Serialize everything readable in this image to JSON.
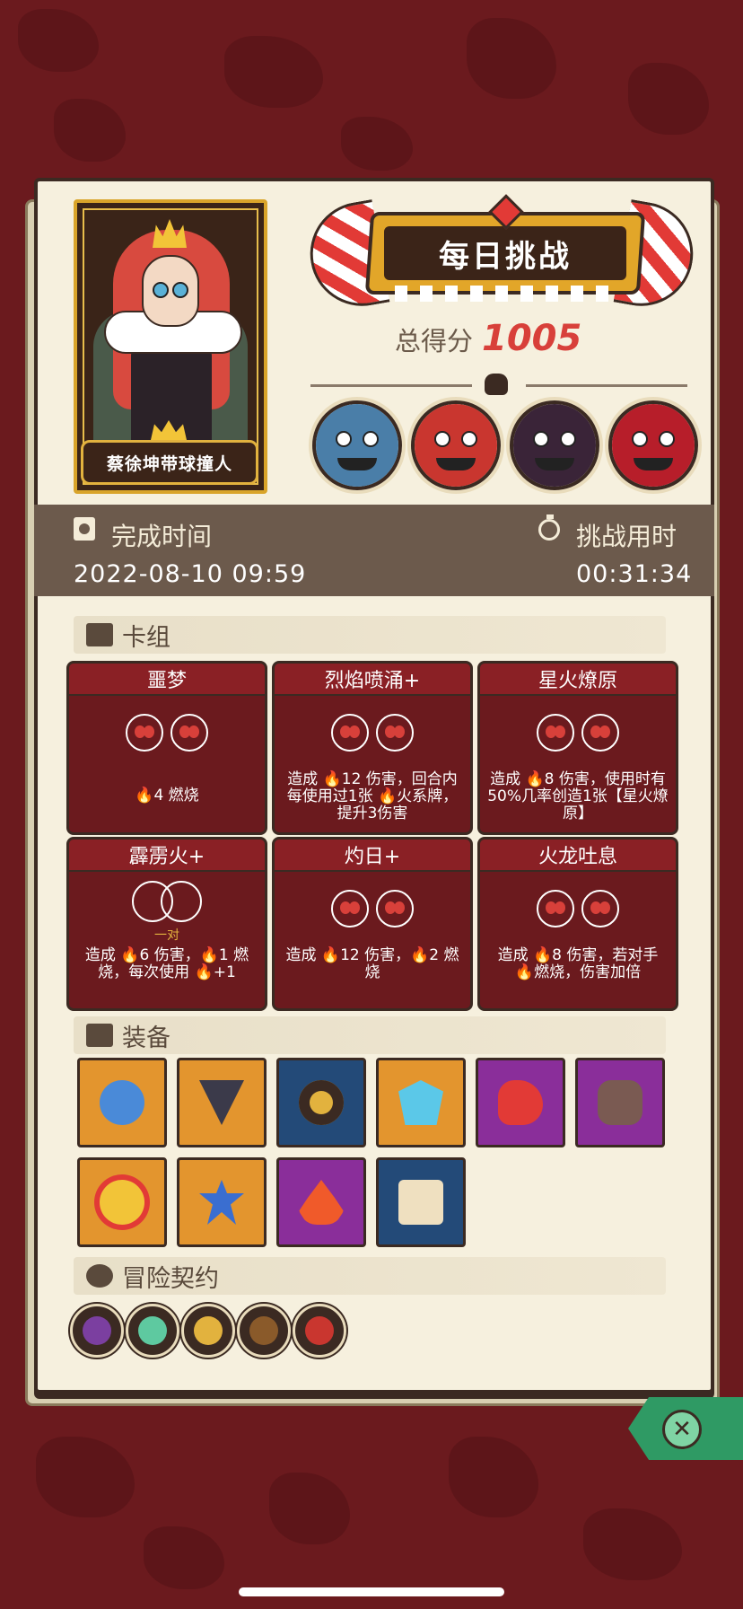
{
  "hero": {
    "name": "蔡徐坤带球撞人"
  },
  "header": {
    "title": "每日挑战",
    "score_label": "总得分",
    "score_value": "1005"
  },
  "enemies": [
    {
      "name": "blue-ogre",
      "color": "#4a7ea8"
    },
    {
      "name": "red-demon",
      "color": "#c9362f"
    },
    {
      "name": "pink-shadow",
      "color": "#3a2438"
    },
    {
      "name": "vampire",
      "color": "#b71e2a"
    }
  ],
  "time": {
    "complete_label": "完成时间",
    "complete_value": "2022-08-10 09:59",
    "challenge_label": "挑战用时",
    "challenge_value": "00:31:34"
  },
  "deck": {
    "label": "卡组",
    "cards": [
      {
        "title": "噩梦",
        "desc": "🔥4 燃烧",
        "cost": 2,
        "upgraded": false
      },
      {
        "title": "烈焰喷涌+",
        "desc": "造成 🔥12 伤害，回合内每使用过1张 🔥火系牌，提升3伤害",
        "cost": 2,
        "upgraded": true
      },
      {
        "title": "星火燎原",
        "desc": "造成 🔥8 伤害，使用时有50%几率创造1张【星火燎原】",
        "cost": 2,
        "upgraded": true
      },
      {
        "title": "霹雳火+",
        "desc": "造成 🔥6 伤害，🔥1 燃烧，每次使用 🔥+1",
        "cost": 0,
        "upgraded": true,
        "pair_label": "一对"
      },
      {
        "title": "灼日+",
        "desc": "造成 🔥12 伤害，🔥2 燃烧",
        "cost": 2,
        "upgraded": true
      },
      {
        "title": "火龙吐息",
        "desc": "造成 🔥8 伤害，若对手 🔥燃烧，伤害加倍",
        "cost": 2,
        "upgraded": true
      }
    ]
  },
  "equipment": {
    "label": "装备",
    "items": [
      {
        "name": "blue-slime-icon",
        "bg": "#e3952e"
      },
      {
        "name": "triangle-amulet-icon",
        "bg": "#e3952e"
      },
      {
        "name": "fire-ring-icon",
        "bg": "#234a78"
      },
      {
        "name": "ice-shield-icon",
        "bg": "#e3952e"
      },
      {
        "name": "red-blade-icon",
        "bg": "#8a2e9a"
      },
      {
        "name": "fire-stone-icon",
        "bg": "#8a2e9a"
      },
      {
        "name": "flame-face-icon",
        "bg": "#e3952e"
      },
      {
        "name": "ice-spike-icon",
        "bg": "#e3952e"
      },
      {
        "name": "flame-icon",
        "bg": "#8a2e9a"
      },
      {
        "name": "scroll-icon",
        "bg": "#234a78"
      }
    ]
  },
  "contracts": {
    "label": "冒险契约",
    "items": [
      {
        "name": "purple-eye-icon",
        "color": "#7b3fa0"
      },
      {
        "name": "green-virus-icon",
        "color": "#5ec9a0"
      },
      {
        "name": "horn-icon",
        "color": "#e2b23e"
      },
      {
        "name": "pipe-icon",
        "color": "#8a5a2a"
      },
      {
        "name": "red-rune-icon",
        "color": "#c9362f"
      }
    ]
  },
  "colors": {
    "panel": "#f6f0de",
    "score": "#d8403a",
    "close": "#2f9a64"
  }
}
